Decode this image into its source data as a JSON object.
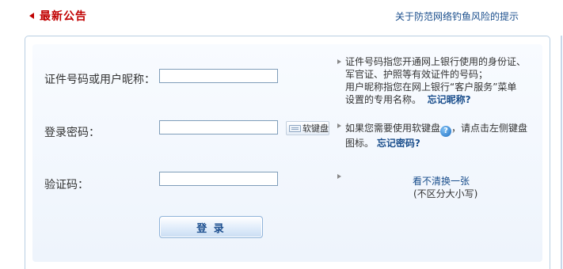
{
  "header": {
    "title": "最新公告",
    "notice_link": "关于防范网络钓鱼风险的提示"
  },
  "form": {
    "id_label": "证件号码或用户昵称：",
    "id_value": "",
    "password_label": "登录密码：",
    "password_value": "",
    "soft_keyboard_label": "软键盘",
    "captcha_label": "验证码：",
    "captcha_value": "",
    "login_button": "登 录"
  },
  "hints": {
    "id": {
      "line1": "证件号码指您开通网上银行使用的身份证、",
      "line2": "军官证、护照等有效证件的号码；",
      "line3": "用户昵称指您在网上银行“客户服务”菜单",
      "line4_text": "设置的专用名称。",
      "forgot_nickname": "忘记昵称?"
    },
    "password": {
      "line1_text": "如果您需要使用软键盘",
      "help_glyph": "?",
      "line1_tail": "，请点击左侧键盘",
      "line2_text": "图标。",
      "forgot_password": "忘记密码?"
    },
    "captcha": {
      "refresh_link": "看不清换一张",
      "case_note": "(不区分大小写)"
    }
  },
  "colors": {
    "title_red": "#c00000",
    "link_blue": "#1a4e8c",
    "panel_border": "#b9cfe3"
  },
  "icons": [
    "title-arrow-icon",
    "keyboard-icon",
    "help-icon",
    "hint-arrow-icon"
  ]
}
